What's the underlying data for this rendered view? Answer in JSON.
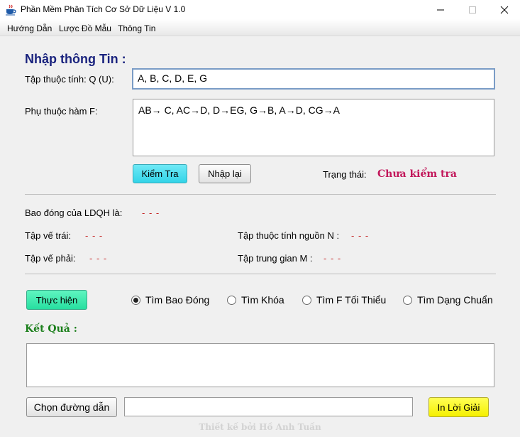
{
  "window": {
    "title": "Phần Mềm Phân Tích Cơ Sở Dữ Liệu V 1.0",
    "icon": "coffee-cup-icon"
  },
  "menu": {
    "items": [
      {
        "label": "Hướng Dẫn"
      },
      {
        "label": "Lược Đồ Mẫu"
      },
      {
        "label": "Thông Tin"
      }
    ]
  },
  "input_section": {
    "heading": "Nhập thông Tin :",
    "attributes_label": "Tập thuộc tính: Q (U):",
    "attributes_value": "A, B, C, D, E, G",
    "fd_label": "Phụ thuộc hàm F:",
    "fd_value": "AB→ C, AC→D, D→EG, G→B, A→D, CG→A",
    "check_button": "Kiểm Tra",
    "reset_button": "Nhập lại",
    "status_label": "Trạng thái:",
    "status_value": "Chưa kiểm tra"
  },
  "info_section": {
    "closure_label": "Bao đóng của LDQH là:",
    "closure_value": "- - -",
    "left_set_label": "Tập vế trái:",
    "left_set_value": "- - -",
    "right_set_label": "Tập vế phải:",
    "right_set_value": "- - -",
    "source_label": "Tập thuộc tính nguồn N :",
    "source_value": "- - -",
    "middle_label": "Tập trung gian M :",
    "middle_value": "- - -"
  },
  "actions": {
    "execute_button": "Thực hiện",
    "options": [
      {
        "label": "Tìm Bao Đóng",
        "selected": true
      },
      {
        "label": "Tìm Khóa",
        "selected": false
      },
      {
        "label": "Tìm F Tối Thiểu",
        "selected": false
      },
      {
        "label": "Tìm Dạng Chuẩn",
        "selected": false
      }
    ]
  },
  "result": {
    "heading": "Kết Quả :",
    "value": "",
    "choose_path_button": "Chọn đường dẫn",
    "path_value": "",
    "print_button": "In Lời Giải"
  },
  "footer": {
    "credit": "Thiết kế bởi Hồ Anh Tuấn"
  },
  "colors": {
    "heading_blue": "#1a237e",
    "status_red": "#c2185b",
    "dash_red": "#c62828",
    "result_green": "#1b7f1b",
    "check_button_bg": "#32d4e8",
    "execute_button_bg": "#27dfa0",
    "print_button_bg": "#f5f000"
  }
}
